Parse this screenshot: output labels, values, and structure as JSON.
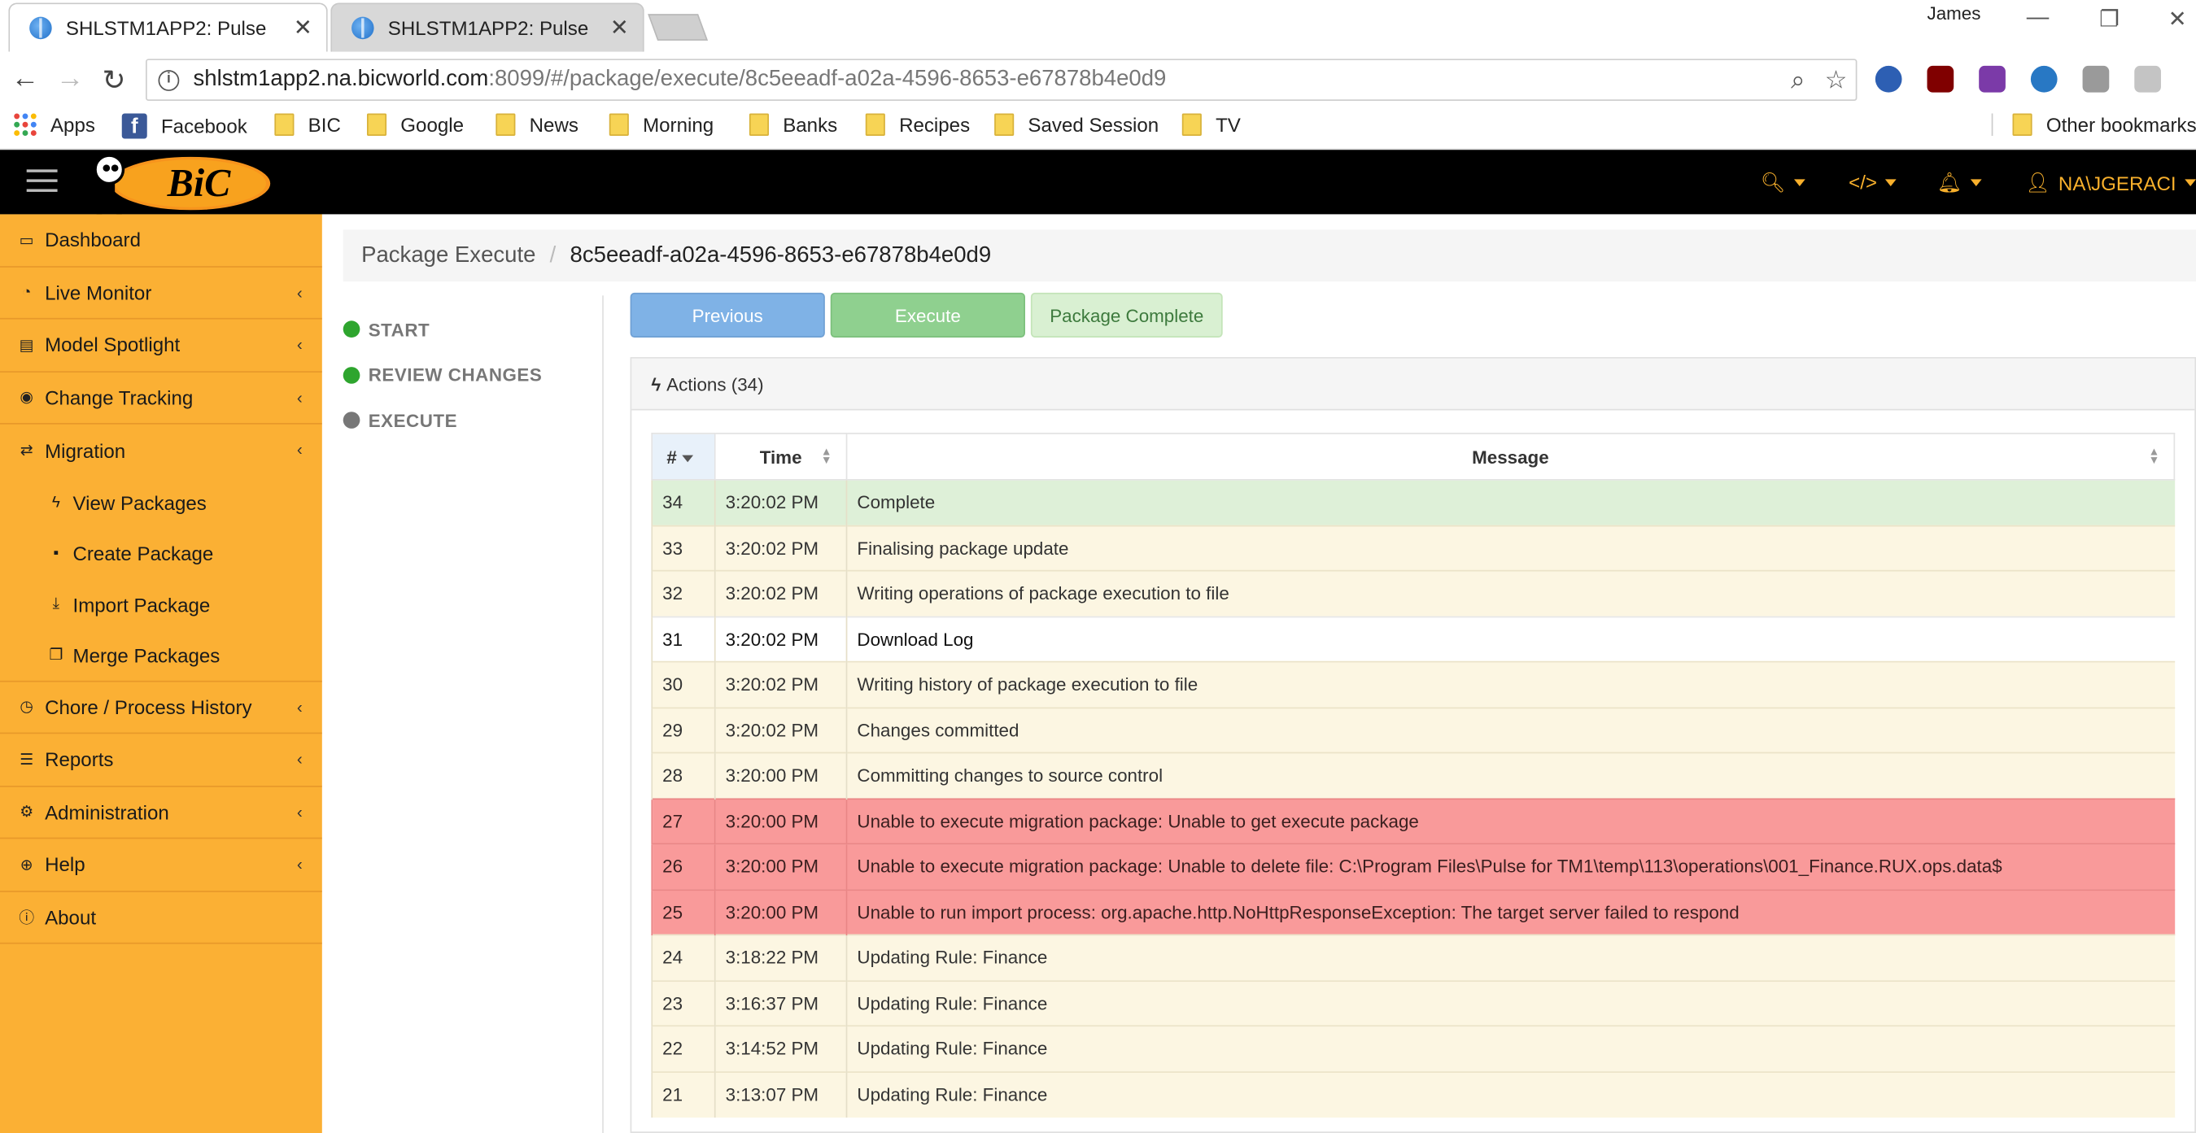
{
  "browser": {
    "tabs": [
      {
        "title": "SHLSTM1APP2: Pulse",
        "active": true
      },
      {
        "title": "SHLSTM1APP2: Pulse",
        "active": false
      }
    ],
    "window_user": "James",
    "url_host": "shlstm1app2.na.bicworld.com",
    "url_rest": ":8099/#/package/execute/8c5eeadf-a02a-4596-8653-e67878b4e0d9",
    "extensions": [
      "facebook-ext-icon",
      "ublock-icon",
      "onenote-icon",
      "metamask-icon",
      "generic-ext-icon",
      "g-ext-icon"
    ],
    "bookmarks": [
      {
        "label": "Apps",
        "icon": "apps-icon"
      },
      {
        "label": "Facebook",
        "icon": "facebook-icon"
      },
      {
        "label": "BIC",
        "icon": "folder-icon"
      },
      {
        "label": "Google",
        "icon": "folder-icon"
      },
      {
        "label": "News",
        "icon": "folder-icon"
      },
      {
        "label": "Morning",
        "icon": "folder-icon"
      },
      {
        "label": "Banks",
        "icon": "folder-icon"
      },
      {
        "label": "Recipes",
        "icon": "folder-icon"
      },
      {
        "label": "Saved Session",
        "icon": "folder-icon"
      },
      {
        "label": "TV",
        "icon": "folder-icon"
      }
    ],
    "other_bookmarks": "Other bookmarks"
  },
  "header": {
    "logo_text": "BiC",
    "user": "NA\\JGERACI"
  },
  "sidebar": {
    "items": [
      {
        "label": "Dashboard",
        "icon": "monitor-icon",
        "chevron": false
      },
      {
        "label": "Live Monitor",
        "icon": "dashboard-gauge-icon",
        "chevron": true
      },
      {
        "label": "Model Spotlight",
        "icon": "list-alt-icon",
        "chevron": true
      },
      {
        "label": "Change Tracking",
        "icon": "eye-icon",
        "chevron": true
      },
      {
        "label": "Migration",
        "icon": "retweet-icon",
        "chevron": true
      }
    ],
    "migration_sub": [
      {
        "label": "View Packages",
        "icon": "bolt-icon"
      },
      {
        "label": "Create Package",
        "icon": "archive-icon"
      },
      {
        "label": "Import Package",
        "icon": "download-icon"
      },
      {
        "label": "Merge Packages",
        "icon": "copy-icon"
      }
    ],
    "items_after": [
      {
        "label": "Chore / Process History",
        "icon": "clock-icon",
        "chevron": true
      },
      {
        "label": "Reports",
        "icon": "list-icon",
        "chevron": true
      },
      {
        "label": "Administration",
        "icon": "cogs-icon",
        "chevron": true
      },
      {
        "label": "Help",
        "icon": "life-ring-icon",
        "chevron": true
      },
      {
        "label": "About",
        "icon": "info-circle-icon",
        "chevron": false
      }
    ]
  },
  "breadcrumb": {
    "first": "Package Execute",
    "active": "8c5eeadf-a02a-4596-8653-e67878b4e0d9"
  },
  "steps": [
    {
      "label": "START",
      "color": "#2ea52e"
    },
    {
      "label": "REVIEW CHANGES",
      "color": "#2ea52e"
    },
    {
      "label": "EXECUTE",
      "color": "#777777"
    }
  ],
  "buttons": {
    "previous": "Previous",
    "execute": "Execute",
    "complete": "Package Complete"
  },
  "panel": {
    "title": "Actions (34)"
  },
  "table": {
    "headers": {
      "num": "#",
      "time": "Time",
      "message": "Message"
    },
    "rows": [
      {
        "num": "34",
        "time": "3:20:02 PM",
        "message": "Complete",
        "status": "success"
      },
      {
        "num": "33",
        "time": "3:20:02 PM",
        "message": "Finalising package update",
        "status": "warning"
      },
      {
        "num": "32",
        "time": "3:20:02 PM",
        "message": "Writing operations of package execution to file",
        "status": "warning"
      },
      {
        "num": "31",
        "time": "3:20:02 PM",
        "message": "Download Log",
        "status": "plain"
      },
      {
        "num": "30",
        "time": "3:20:02 PM",
        "message": "Writing history of package execution to file",
        "status": "warning"
      },
      {
        "num": "29",
        "time": "3:20:02 PM",
        "message": "Changes committed",
        "status": "warning"
      },
      {
        "num": "28",
        "time": "3:20:00 PM",
        "message": "Committing changes to source control",
        "status": "warning"
      },
      {
        "num": "27",
        "time": "3:20:00 PM",
        "message": "Unable to execute migration package: Unable to get execute package",
        "status": "danger"
      },
      {
        "num": "26",
        "time": "3:20:00 PM",
        "message": "Unable to execute migration package: Unable to delete file: C:\\Program Files\\Pulse for TM1\\temp\\113\\operations\\001_Finance.RUX.ops.data$",
        "status": "danger"
      },
      {
        "num": "25",
        "time": "3:20:00 PM",
        "message": "Unable to run import process: org.apache.http.NoHttpResponseException: The target server failed to respond",
        "status": "danger"
      },
      {
        "num": "24",
        "time": "3:18:22 PM",
        "message": "Updating Rule: Finance",
        "status": "warning"
      },
      {
        "num": "23",
        "time": "3:16:37 PM",
        "message": "Updating Rule: Finance",
        "status": "warning"
      },
      {
        "num": "22",
        "time": "3:14:52 PM",
        "message": "Updating Rule: Finance",
        "status": "warning"
      },
      {
        "num": "21",
        "time": "3:13:07 PM",
        "message": "Updating Rule: Finance",
        "status": "warning"
      }
    ]
  },
  "colors": {
    "sidebar_bg": "#fbb034",
    "header_bg": "#000000",
    "accent": "#f8b02c",
    "danger_row": "#f99a9a",
    "success_row": "#def0d8",
    "warning_row": "#fcf6e2"
  }
}
